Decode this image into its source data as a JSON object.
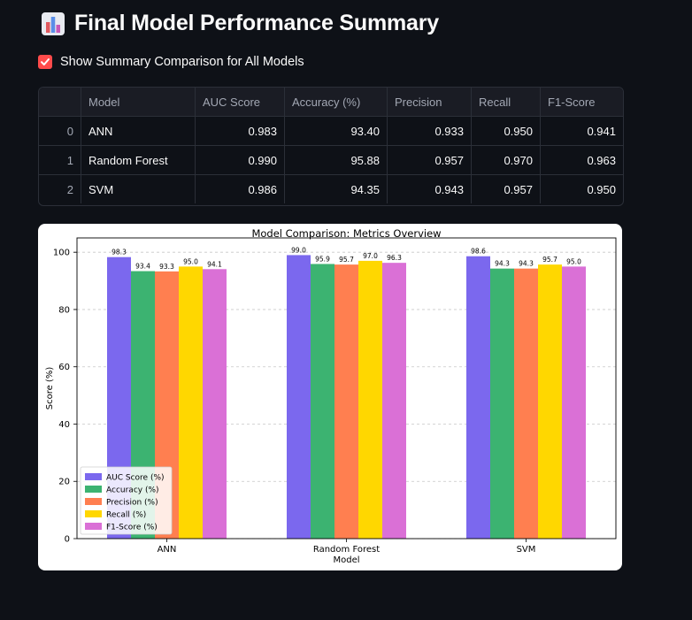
{
  "page": {
    "title": "Final Model Performance Summary",
    "title_icon": "bar-chart-icon"
  },
  "toggle": {
    "label": "Show Summary Comparison for All Models",
    "checked": true
  },
  "table": {
    "columns": [
      "",
      "Model",
      "AUC Score",
      "Accuracy (%)",
      "Precision",
      "Recall",
      "F1-Score"
    ],
    "rows": [
      [
        "0",
        "ANN",
        "0.983",
        "93.40",
        "0.933",
        "0.950",
        "0.941"
      ],
      [
        "1",
        "Random Forest",
        "0.990",
        "95.88",
        "0.957",
        "0.970",
        "0.963"
      ],
      [
        "2",
        "SVM",
        "0.986",
        "94.35",
        "0.943",
        "0.957",
        "0.950"
      ]
    ]
  },
  "colors": {
    "accent": "#ff4b4b",
    "background": "#0e1117"
  },
  "chart_data": {
    "type": "bar",
    "title": "Model Comparison: Metrics Overview",
    "xlabel": "Model",
    "ylabel": "Score (%)",
    "categories": [
      "ANN",
      "Random Forest",
      "SVM"
    ],
    "ylim": [
      0,
      105
    ],
    "yticks": [
      0,
      20,
      40,
      60,
      80,
      100
    ],
    "grid": "horizontal-dashed",
    "legend_position": "lower-left",
    "series": [
      {
        "name": "AUC Score (%)",
        "color": "#7b68ee",
        "values": [
          98.3,
          99.0,
          98.6
        ]
      },
      {
        "name": "Accuracy (%)",
        "color": "#3cb371",
        "values": [
          93.4,
          95.9,
          94.3
        ]
      },
      {
        "name": "Precision (%)",
        "color": "#ff7f50",
        "values": [
          93.3,
          95.7,
          94.3
        ]
      },
      {
        "name": "Recall (%)",
        "color": "#ffd700",
        "values": [
          95.0,
          97.0,
          95.7
        ]
      },
      {
        "name": "F1-Score (%)",
        "color": "#da70d6",
        "values": [
          94.1,
          96.3,
          95.0
        ]
      }
    ]
  }
}
